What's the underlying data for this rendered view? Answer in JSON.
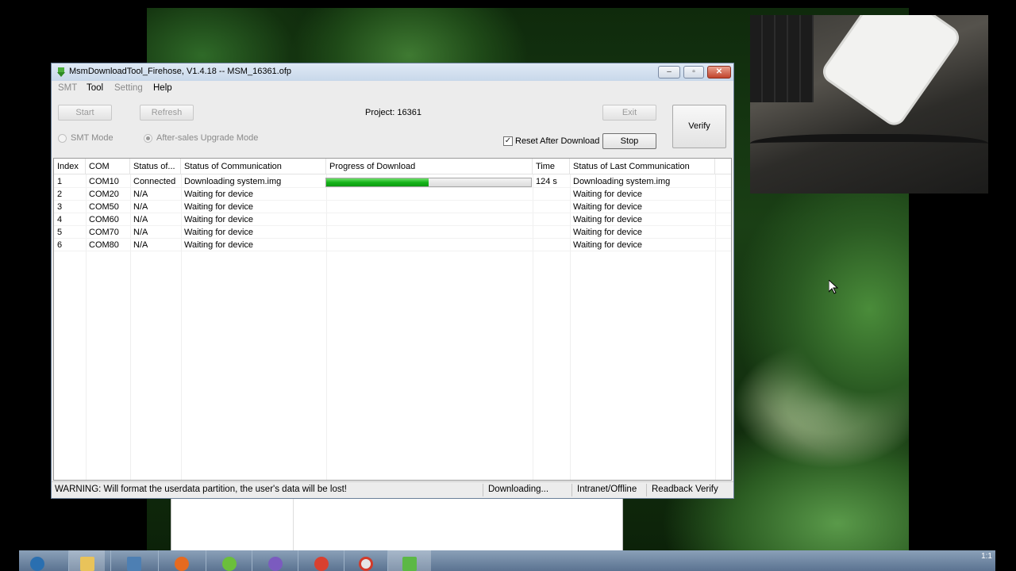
{
  "window": {
    "title": "MsmDownloadTool_Firehose, V1.4.18 -- MSM_16361.ofp",
    "controls": {
      "minimize": "–",
      "maximize": "▫",
      "close": "✕"
    }
  },
  "menu": {
    "smt": "SMT",
    "tool": "Tool",
    "setting": "Setting",
    "help": "Help"
  },
  "toolbar": {
    "start": "Start",
    "refresh": "Refresh",
    "project": "Project: 16361",
    "exit": "Exit",
    "verify": "Verify",
    "stop": "Stop",
    "smt_mode": "SMT Mode",
    "aftersales_mode": "After-sales Upgrade Mode",
    "reset_after_download": "Reset After Download",
    "reset_checked": true,
    "aftersales_selected": true
  },
  "table": {
    "headers": [
      "Index",
      "COM",
      "Status of...",
      "Status of Communication",
      "Progress of Download",
      "Time",
      "Status of Last Communication"
    ],
    "rows": [
      {
        "index": "1",
        "com": "COM10",
        "status": "Connected",
        "comm": "Downloading system.img",
        "progress": 0.5,
        "time": "124 s",
        "last": "Downloading system.img"
      },
      {
        "index": "2",
        "com": "COM20",
        "status": "N/A",
        "comm": "Waiting for device",
        "progress": null,
        "time": "",
        "last": "Waiting for device"
      },
      {
        "index": "3",
        "com": "COM50",
        "status": "N/A",
        "comm": "Waiting for device",
        "progress": null,
        "time": "",
        "last": "Waiting for device"
      },
      {
        "index": "4",
        "com": "COM60",
        "status": "N/A",
        "comm": "Waiting for device",
        "progress": null,
        "time": "",
        "last": "Waiting for device"
      },
      {
        "index": "5",
        "com": "COM70",
        "status": "N/A",
        "comm": "Waiting for device",
        "progress": null,
        "time": "",
        "last": "Waiting for device"
      },
      {
        "index": "6",
        "com": "COM80",
        "status": "N/A",
        "comm": "Waiting for device",
        "progress": null,
        "time": "",
        "last": "Waiting for device"
      }
    ]
  },
  "statusbar": {
    "warning": "WARNING: Will format the userdata partition, the user's data will be lost!",
    "state": "Downloading...",
    "network": "Intranet/Offline",
    "readback": "Readback Verify"
  },
  "taskbar": {
    "clock": "1:1"
  },
  "colors": {
    "progress_green": "#16b41a",
    "titlebar": "#c8d8ea",
    "close_red": "#c1442c"
  }
}
